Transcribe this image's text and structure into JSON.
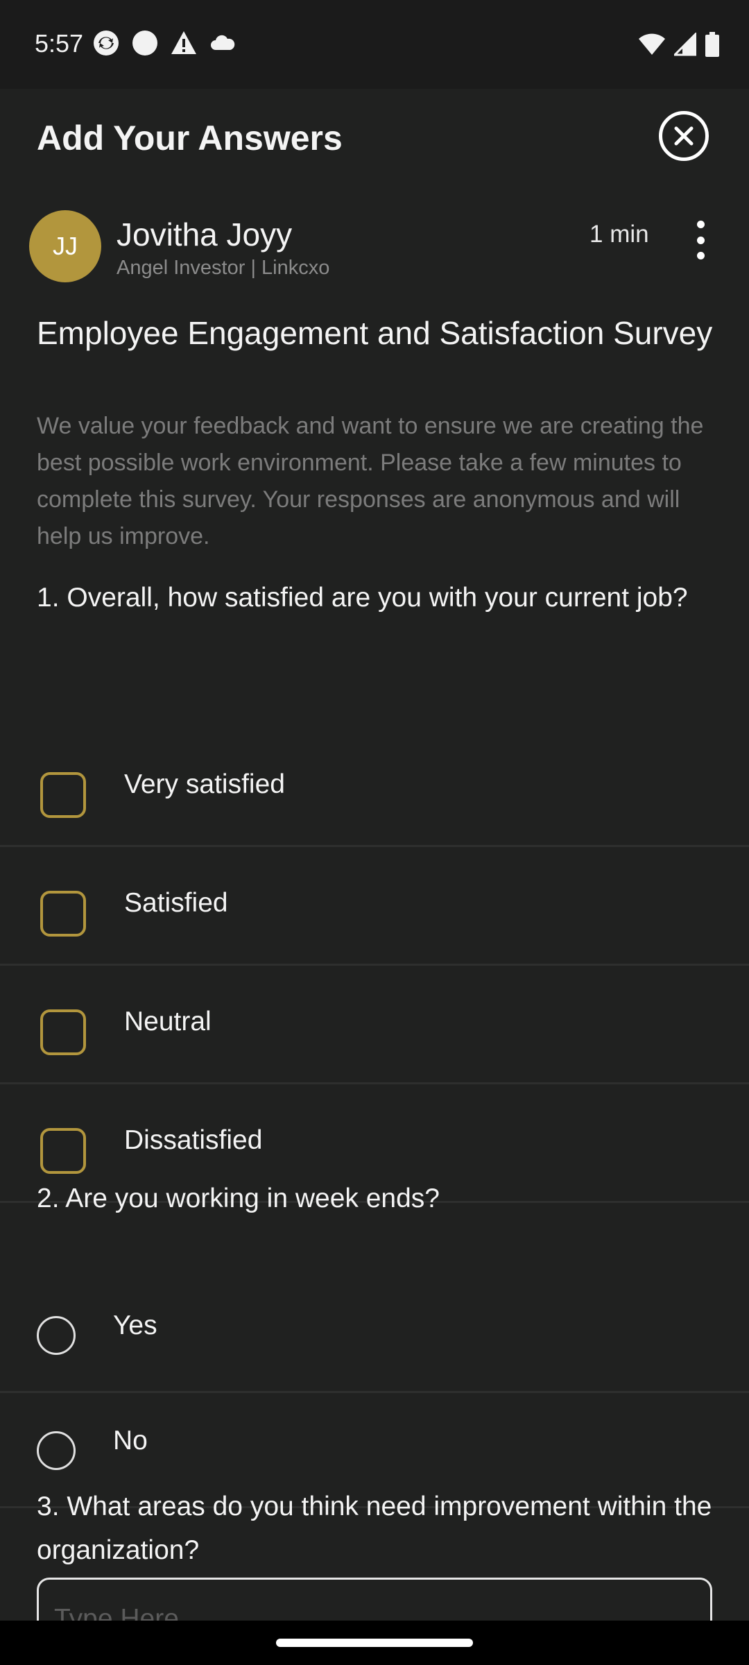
{
  "status_bar": {
    "time": "5:57",
    "left_icons": [
      "sync-icon",
      "circle-icon",
      "warning-icon",
      "cloud-icon"
    ],
    "right_icons": [
      "wifi-icon",
      "cell-signal-icon",
      "battery-icon"
    ]
  },
  "sheet": {
    "title": "Add Your Answers",
    "close_icon": "close-icon"
  },
  "author": {
    "initials": "JJ",
    "name": "Jovitha Joyy",
    "subtitle": "Angel Investor | Linkcxo",
    "duration": "1 min",
    "avatar_color": "#b2963d"
  },
  "survey": {
    "title": "Employee Engagement and Satisfaction Survey",
    "description": "We value your feedback and want to ensure we are creating the best possible work environment. Please take a few minutes to complete this survey. Your responses are anonymous and will help us improve."
  },
  "questions": [
    {
      "text": "1. Overall, how satisfied are you with your current job?",
      "type": "checkbox",
      "options": [
        "Very satisfied",
        "Satisfied",
        "Neutral",
        "Dissatisfied"
      ]
    },
    {
      "text": "2. Are you working in week ends?",
      "type": "radio",
      "options": [
        "Yes",
        "No"
      ]
    },
    {
      "text": "3. What areas do you think need improvement within the organization?",
      "type": "text",
      "placeholder": "Type Here"
    }
  ],
  "colors": {
    "accent": "#b2963d",
    "background": "#202120",
    "muted_text": "#7c7c7c"
  }
}
